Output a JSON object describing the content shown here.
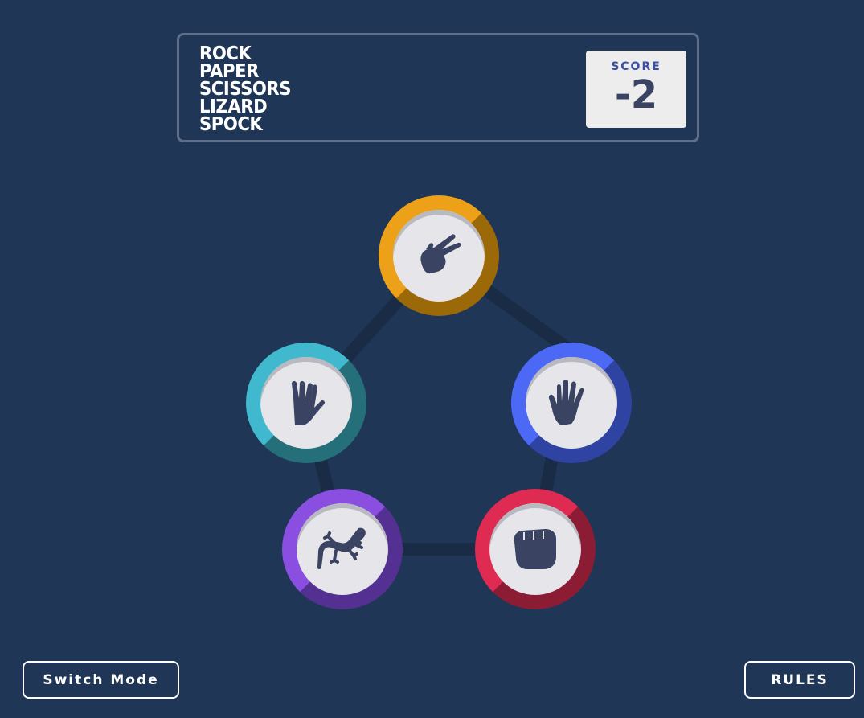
{
  "header": {
    "title_lines": [
      "ROCK",
      "PAPER",
      "SCISSORS",
      "LIZARD",
      "SPOCK"
    ],
    "score_label": "SCORE",
    "score_value": "-2"
  },
  "tokens": [
    {
      "id": "scissors",
      "icon": "scissors-hand-icon",
      "color_light": "#eca118",
      "color_dark": "#9c6908"
    },
    {
      "id": "paper",
      "icon": "open-hand-icon",
      "color_light": "#4c69f6",
      "color_dark": "#2e43a2"
    },
    {
      "id": "rock",
      "icon": "fist-icon",
      "color_light": "#df2b51",
      "color_dark": "#8b1c34"
    },
    {
      "id": "lizard",
      "icon": "lizard-icon",
      "color_light": "#8a4fe0",
      "color_dark": "#553093"
    },
    {
      "id": "spock",
      "icon": "vulcan-salute-icon",
      "color_light": "#40b9ce",
      "color_dark": "#246f79"
    }
  ],
  "buttons": {
    "switch_mode": "Switch Mode",
    "rules": "RULES"
  }
}
